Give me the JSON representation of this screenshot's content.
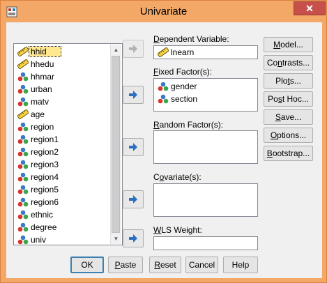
{
  "window": {
    "title": "Univariate",
    "close_label": "✕"
  },
  "variables": [
    {
      "name": "hhid",
      "type": "scale",
      "selected": true
    },
    {
      "name": "hhedu",
      "type": "scale"
    },
    {
      "name": "hhmar",
      "type": "nominal"
    },
    {
      "name": "urban",
      "type": "nominal"
    },
    {
      "name": "matv",
      "type": "nominal"
    },
    {
      "name": "age",
      "type": "scale"
    },
    {
      "name": "region",
      "type": "nominal"
    },
    {
      "name": "region1",
      "type": "nominal"
    },
    {
      "name": "region2",
      "type": "nominal"
    },
    {
      "name": "region3",
      "type": "nominal"
    },
    {
      "name": "region4",
      "type": "nominal"
    },
    {
      "name": "region5",
      "type": "nominal"
    },
    {
      "name": "region6",
      "type": "nominal"
    },
    {
      "name": "ethnic",
      "type": "nominal"
    },
    {
      "name": "degree",
      "type": "nominal"
    },
    {
      "name": "univ",
      "type": "nominal"
    }
  ],
  "dependent": {
    "label_pre": "",
    "label_u": "D",
    "label_post": "ependent Variable:",
    "value": "lnearn",
    "type": "scale"
  },
  "fixed": {
    "label_u": "F",
    "label_post": "ixed Factor(s):",
    "items": [
      {
        "name": "gender",
        "type": "nominal"
      },
      {
        "name": "section",
        "type": "nominal"
      }
    ]
  },
  "random": {
    "label_u": "R",
    "label_post": "andom Factor(s):"
  },
  "covariate": {
    "label_pre": "C",
    "label_u": "o",
    "label_post": "variate(s):"
  },
  "wls": {
    "label_pre": "",
    "label_u": "W",
    "label_post": "LS Weight:"
  },
  "side_buttons": [
    {
      "pre": "",
      "u": "M",
      "post": "odel..."
    },
    {
      "pre": "Co",
      "u": "n",
      "post": "trasts..."
    },
    {
      "pre": "Plo",
      "u": "t",
      "post": "s..."
    },
    {
      "pre": "Po",
      "u": "s",
      "post": "t Hoc..."
    },
    {
      "pre": "",
      "u": "S",
      "post": "ave..."
    },
    {
      "pre": "",
      "u": "O",
      "post": "ptions..."
    },
    {
      "pre": "",
      "u": "B",
      "post": "ootstrap..."
    }
  ],
  "bottom_buttons": [
    {
      "pre": "OK",
      "u": "",
      "post": ""
    },
    {
      "pre": "",
      "u": "P",
      "post": "aste"
    },
    {
      "pre": "",
      "u": "R",
      "post": "eset"
    },
    {
      "pre": "Cancel",
      "u": "",
      "post": ""
    },
    {
      "pre": "Help",
      "u": "",
      "post": ""
    }
  ],
  "colors": {
    "titlebar": "#f3a868",
    "accent": "#3c7fb1",
    "selection": "#ffe88f"
  }
}
